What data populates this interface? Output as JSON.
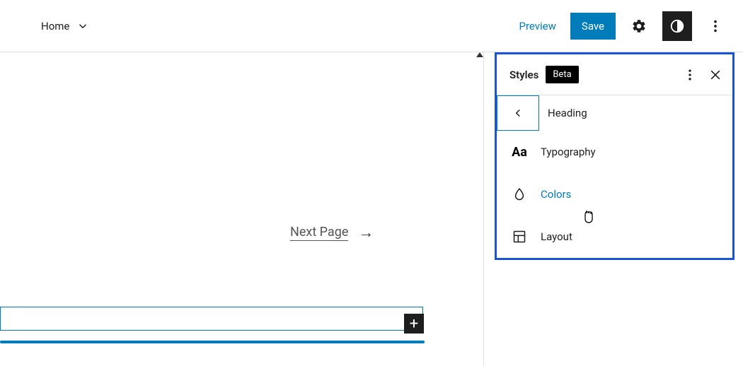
{
  "topbar": {
    "home": "Home",
    "preview": "Preview",
    "save": "Save"
  },
  "content": {
    "next_page": "Next Page"
  },
  "panel": {
    "title": "Styles",
    "badge": "Beta",
    "heading": "Heading",
    "items": [
      {
        "label": "Typography"
      },
      {
        "label": "Colors"
      },
      {
        "label": "Layout"
      }
    ]
  }
}
